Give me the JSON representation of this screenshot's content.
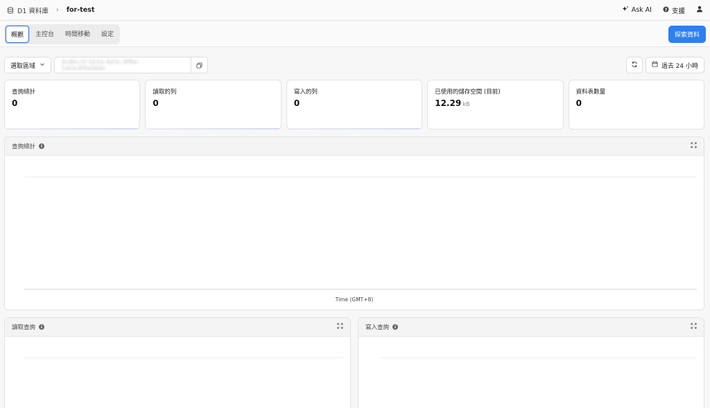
{
  "breadcrumb": {
    "parent": "D1 資料庫",
    "current": "for-test"
  },
  "topright": {
    "ask_ai": "Ask AI",
    "support": "支援"
  },
  "tabs": [
    "概觀",
    "主控台",
    "時間移動",
    "設定"
  ],
  "explore_button": "探索資料",
  "filters": {
    "region_label": "選取區域",
    "db_id": "9c8bc1f-1b2a-4d3c-9f8e-1d2e3f4a5b6c",
    "time_range": "過去 24 小時"
  },
  "stats": [
    {
      "label": "查詢總計",
      "value": "0",
      "unit": ""
    },
    {
      "label": "讀取的列",
      "value": "0",
      "unit": ""
    },
    {
      "label": "寫入的列",
      "value": "0",
      "unit": ""
    },
    {
      "label": "已使用的儲存空間 (目前)",
      "value": "12.29",
      "unit": "kB"
    },
    {
      "label": "資料表數量",
      "value": "0",
      "unit": ""
    }
  ],
  "panels": {
    "total_queries": {
      "title": "查詢總計",
      "xlabel": "Time (GMT+8)"
    },
    "read_queries": {
      "title": "讀取查詢"
    },
    "write_queries": {
      "title": "寫入查詢"
    }
  },
  "colors": {
    "accent": "#2f7ff1",
    "tab_border": "#2f6fe6"
  }
}
